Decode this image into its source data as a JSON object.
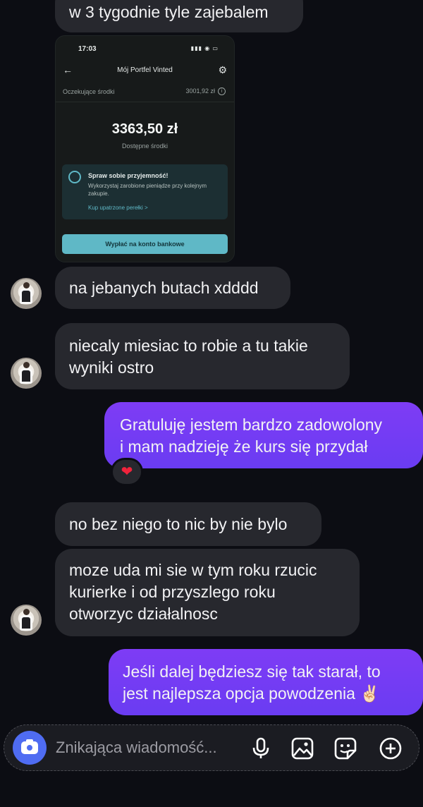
{
  "messages": {
    "m1": [
      "w 3 tygodnie tyle zajebalem"
    ],
    "m2": [
      "na jebanych butach xdddd"
    ],
    "m3": [
      "niecaly miesiac to robie a tu takie",
      "wyniki ostro"
    ],
    "m4": [
      "Gratuluję jestem bardzo zadowolony",
      "i mam nadzieję że kurs się przydał"
    ],
    "m5": [
      "no bez niego to nic by nie bylo"
    ],
    "m6": [
      "moze uda mi sie w tym roku rzucic",
      "kurierke i od przyszlego roku",
      "otworzyc działalnosc"
    ],
    "m7": [
      "Jeśli dalej będziesz się tak starał, to",
      "jest najlepsza opcja powodzenia ✌🏻"
    ]
  },
  "reaction": "❤",
  "screenshot": {
    "time": "17:03",
    "title": "Mój Portfel Vinted",
    "pending_label": "Oczekujące środki",
    "pending_value": "3001,92 zł",
    "balance": "3363,50 zł",
    "balance_label": "Dostępne środki",
    "promo_title": "Spraw sobie przyjemność!",
    "promo_text": "Wykorzystaj zarobione pieniądze przy kolejnym zakupie.",
    "promo_link": "Kup upatrzone perełki >",
    "withdraw_button": "Wypłać na konto bankowe"
  },
  "composer": {
    "placeholder": "Znikająca wiadomość..."
  },
  "colors": {
    "background": "#0c0d13",
    "incoming_bubble": "#27282e",
    "outgoing_bubble": "#7e3cf5",
    "camera_button": "#4f6cf2"
  },
  "icons": [
    "camera-icon",
    "microphone-icon",
    "gallery-icon",
    "sticker-icon",
    "plus-icon",
    "heart-icon",
    "settings-icon",
    "back-arrow-icon"
  ]
}
